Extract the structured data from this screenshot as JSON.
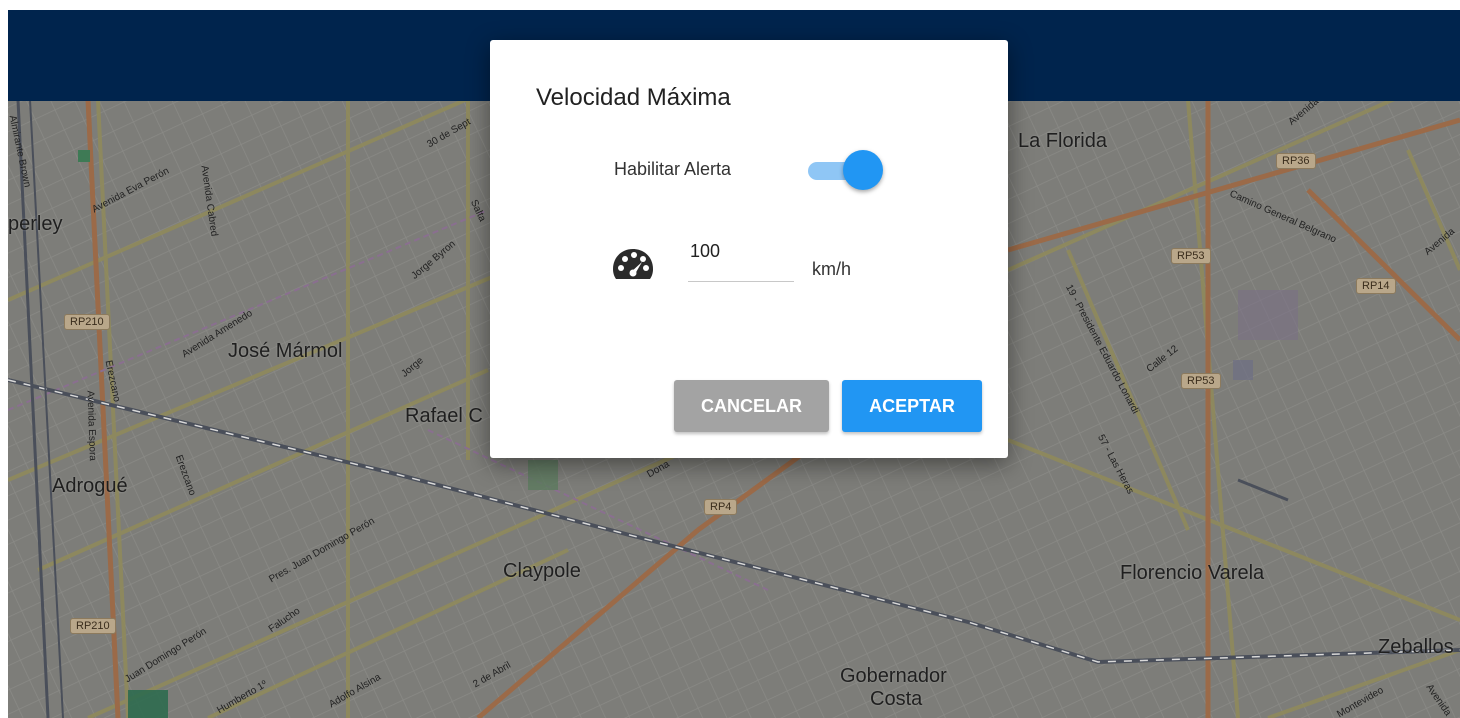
{
  "dialog": {
    "title": "Velocidad Máxima",
    "alert_label": "Habilitar Alerta",
    "alert_enabled": true,
    "speed_value": "100",
    "speed_unit": "km/h",
    "speed_icon": "speedometer-icon",
    "cancel_label": "CANCELAR",
    "accept_label": "ACEPTAR"
  },
  "colors": {
    "topbar": "#00244d",
    "primary": "#2196f3",
    "toggle_track": "#8fc6f5",
    "cancel": "#a3a3a3"
  },
  "map": {
    "places": [
      "La Florida",
      "perley",
      "José Mármol",
      "Rafael C",
      "Adrogué",
      "Claypole",
      "Florencio Varela",
      "Zeballos",
      "Gobernador",
      "Costa"
    ],
    "streets": [
      "Almirante Brown",
      "Avenida Eva Perón",
      "Avenida Cabred",
      "30 de Sept",
      "Salta",
      "Jorge Byron",
      "Avenida Amenedo",
      "Erezcano",
      "Jorge",
      "Avenida Espora",
      "Erezcano",
      "Pres. Juan Domingo Perón",
      "Juan Domingo Perón",
      "Falucho",
      "Humberto 1º",
      "Adolfo Alsina",
      "2 de Abril",
      "Dona",
      "Camino General Belgrano",
      "19 - Presidente Eduardo Lonardi",
      "Calle 12",
      "57 - Las Heras",
      "Avenida",
      "Avenida",
      "Montevideo",
      "Avenida"
    ],
    "shields": [
      "RP36",
      "RP53",
      "RP14",
      "RP53",
      "RP210",
      "RP210",
      "RP4"
    ]
  }
}
